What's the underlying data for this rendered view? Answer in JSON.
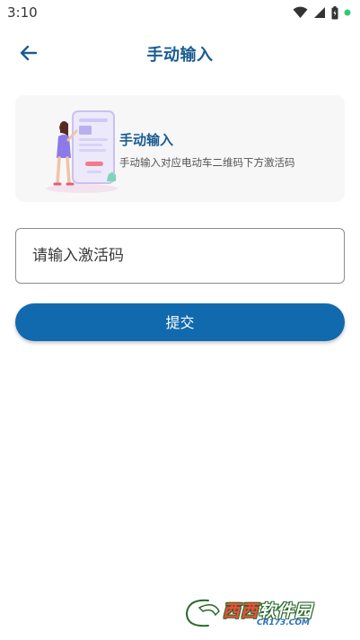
{
  "status_bar": {
    "time": "3:10",
    "icons": [
      "wifi-icon",
      "signal-icon",
      "battery-icon",
      "notification-dot-icon"
    ],
    "dot_color": "#2ecc71"
  },
  "app_bar": {
    "title": "手动输入",
    "back_icon": "arrow-left-icon"
  },
  "info_card": {
    "title": "手动输入",
    "description": "手动输入对应电动车二维码下方激活码"
  },
  "form": {
    "code_placeholder": "请输入激活码",
    "code_value": "",
    "submit_label": "提交"
  },
  "watermark": {
    "brand_red": "西西",
    "brand_white": "软件园",
    "url": "CR173.COM"
  },
  "colors": {
    "primary": "#106aad",
    "title": "#1a5c92",
    "card_bg": "#f7f7f7"
  }
}
